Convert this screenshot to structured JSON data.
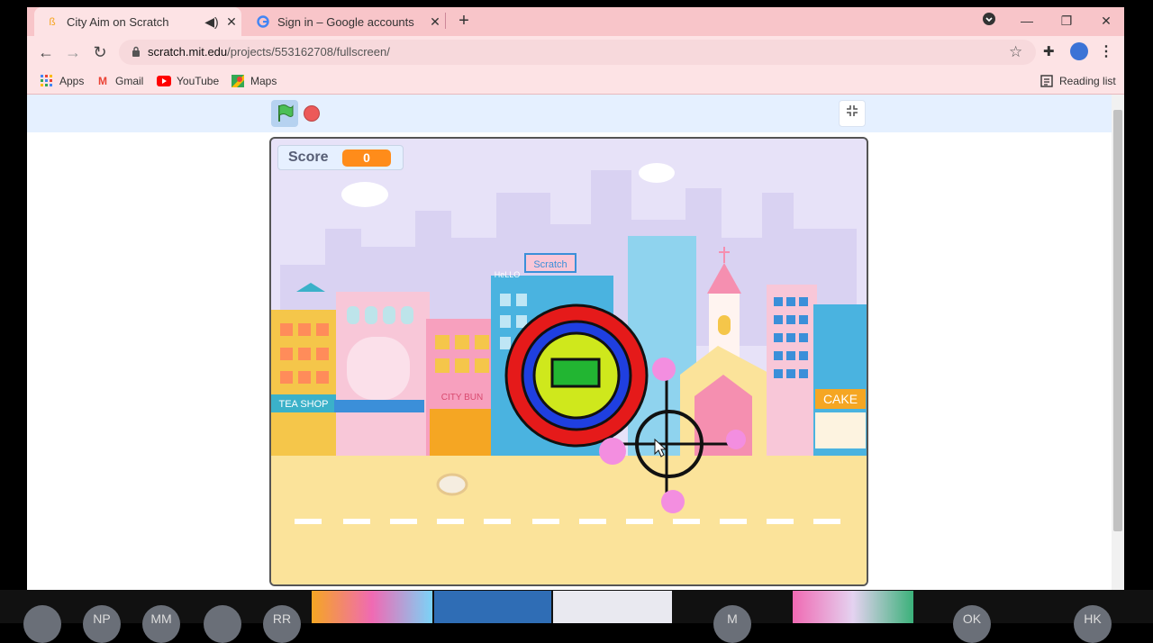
{
  "browser": {
    "tabs": [
      {
        "title": "City Aim on Scratch",
        "active": true
      },
      {
        "title": "Sign in – Google accounts",
        "active": false
      }
    ],
    "url_host": "scratch.mit.edu",
    "url_path": "/projects/553162708/fullscreen/",
    "bookmarks": [
      "Apps",
      "Gmail",
      "YouTube",
      "Maps"
    ],
    "reading_list": "Reading list"
  },
  "stage": {
    "score_label": "Score",
    "score_value": "0",
    "signs": {
      "helo": "HeLLO",
      "scratch": "Scratch",
      "tea_shop": "TEA SHOP",
      "city_bun": "CITY BUN",
      "cake": "CAKE"
    }
  },
  "taskbar": {
    "participants": [
      "NP",
      "MM",
      "RR",
      "M",
      "OK",
      "HK"
    ]
  },
  "colors": {
    "tab_strip": "#f8c5c9",
    "toolbar": "#fde3e5",
    "stage_sky": "#e7e2f8",
    "ground": "#fbe39a",
    "score_value_bg": "#ff8c1a"
  }
}
